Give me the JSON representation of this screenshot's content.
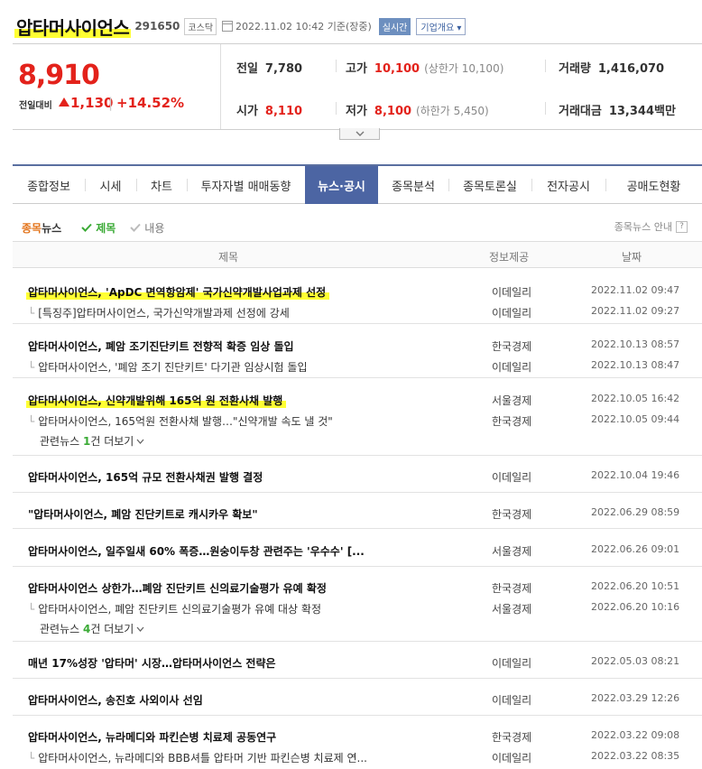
{
  "header": {
    "company": "압타머사이언스",
    "code": "291650",
    "market": "코스닥",
    "datetime": "2022.11.02 10:42 기준(장중)",
    "realtime": "실시간",
    "company_info": "기업개요"
  },
  "quote": {
    "price": "8,910",
    "prev_label": "전일대비",
    "change": "1,130",
    "change_pct": "+14.52%",
    "prev_close_label": "전일",
    "prev_close": "7,780",
    "high_label": "고가",
    "high": "10,100",
    "upper_limit": "(상한가 10,100)",
    "volume_label": "거래량",
    "volume": "1,416,070",
    "open_label": "시가",
    "open": "8,110",
    "low_label": "저가",
    "low": "8,100",
    "lower_limit": "(하한가 5,450)",
    "amount_label": "거래대금",
    "amount": "13,344",
    "amount_unit": "백만"
  },
  "tabs": [
    "종합정보",
    "시세",
    "차트",
    "투자자별 매매동향",
    "뉴스·공시",
    "종목분석",
    "종목토론실",
    "전자공시",
    "공매도현황"
  ],
  "active_tab": "뉴스·공시",
  "filter": {
    "title_a": "종목",
    "title_b": "뉴스",
    "opt_title": "제목",
    "opt_content": "내용",
    "guide": "종목뉴스 안내",
    "help": "?"
  },
  "table": {
    "col_title": "제목",
    "col_source": "정보제공",
    "col_date": "날짜"
  },
  "news": [
    {
      "main": {
        "title": "압타머사이언스, 'ApDC 면역항암제' 국가신약개발사업과제 선정",
        "source": "이데일리",
        "date": "2022.11.02 09:47"
      },
      "related": [
        {
          "title": "[특징주]압타머사이언스, 국가신약개발과제 선정에 강세",
          "source": "이데일리",
          "date": "2022.11.02 09:27"
        }
      ]
    },
    {
      "main": {
        "title": "압타머사이언스, 폐암 조기진단키트 전향적 확증 임상 돌입",
        "source": "한국경제",
        "date": "2022.10.13 08:57"
      },
      "related": [
        {
          "title": "압타머사이언스, '폐암 조기 진단키트' 다기관 임상시험 돌입",
          "source": "이데일리",
          "date": "2022.10.13 08:47"
        }
      ]
    },
    {
      "main": {
        "title": "압타머사이언스, 신약개발위해 165억 원 전환사채 발행",
        "source": "서울경제",
        "date": "2022.10.05 16:42"
      },
      "related": [
        {
          "title": "압타머사이언스, 165억원 전환사채 발행…\"신약개발 속도 낼 것\"",
          "source": "한국경제",
          "date": "2022.10.05 09:44"
        }
      ],
      "more": {
        "prefix": "관련뉴스 ",
        "count": "1",
        "suffix": "건 더보기"
      }
    },
    {
      "main": {
        "title": "압타머사이언스, 165억 규모 전환사채권 발행 결정",
        "source": "이데일리",
        "date": "2022.10.04 19:46"
      }
    },
    {
      "main": {
        "title": "\"압타머사이언스, 폐암 진단키트로 캐시카우 확보\"",
        "source": "한국경제",
        "date": "2022.06.29 08:59"
      }
    },
    {
      "main": {
        "title": "압타머사이언스, 일주일새 60% 폭증…원숭이두창 관련주는 '우수수' [...",
        "source": "서울경제",
        "date": "2022.06.26 09:01"
      }
    },
    {
      "main": {
        "title": "압타머사이언스 상한가…폐암 진단키트 신의료기술평가 유예 확정",
        "source": "한국경제",
        "date": "2022.06.20 10:51"
      },
      "related": [
        {
          "title": "압타머사이언스, 폐암 진단키트 신의료기술평가 유예 대상 확정",
          "source": "서울경제",
          "date": "2022.06.20 10:16"
        }
      ],
      "more": {
        "prefix": "관련뉴스 ",
        "count": "4",
        "suffix": "건 더보기"
      }
    },
    {
      "main": {
        "title": "매년 17%성장 '압타머' 시장…압타머사이언스 전략은",
        "source": "이데일리",
        "date": "2022.05.03 08:21"
      }
    },
    {
      "main": {
        "title": "압타머사이언스, 송진호 사외이사 선임",
        "source": "이데일리",
        "date": "2022.03.29 12:26"
      }
    },
    {
      "main": {
        "title": "압타머사이언스, 뉴라메디와 파킨슨병 치료제 공동연구",
        "source": "한국경제",
        "date": "2022.03.22 09:08"
      },
      "related": [
        {
          "title": "압타머사이언스, 뉴라메디와 BBB셔틀 압타머 기반 파킨슨병 치료제 연...",
          "source": "이데일리",
          "date": "2022.03.22 08:35"
        }
      ]
    }
  ],
  "colors": {
    "up": "#e3221b",
    "down": "#1e5bc6",
    "tab_active": "#4c65a3",
    "highlight": "#ffff33",
    "check": "#3aaa35"
  }
}
